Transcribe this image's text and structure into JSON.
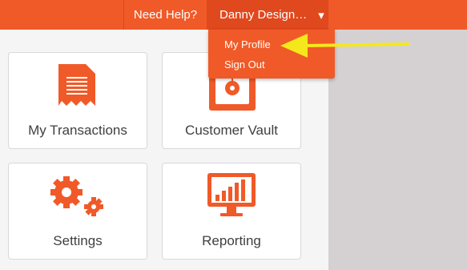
{
  "topbar": {
    "help_label": "Need Help?",
    "user_name": "Danny Design…",
    "caret": "▾"
  },
  "dropdown": {
    "items": [
      {
        "label": "My Profile"
      },
      {
        "label": "Sign Out"
      }
    ]
  },
  "tiles": [
    {
      "label": "My Transactions",
      "icon": "receipt-icon"
    },
    {
      "label": "Customer Vault",
      "icon": "vault-icon"
    },
    {
      "label": "Settings",
      "icon": "gears-icon"
    },
    {
      "label": "Reporting",
      "icon": "monitor-chart-icon"
    }
  ],
  "colors": {
    "accent": "#f05a28",
    "accent_dark": "#e0481d",
    "arrow": "#f4e81c",
    "tile_text": "#404040",
    "panel_bg": "#f5f5f5",
    "side_bg": "#d5d1d3"
  }
}
